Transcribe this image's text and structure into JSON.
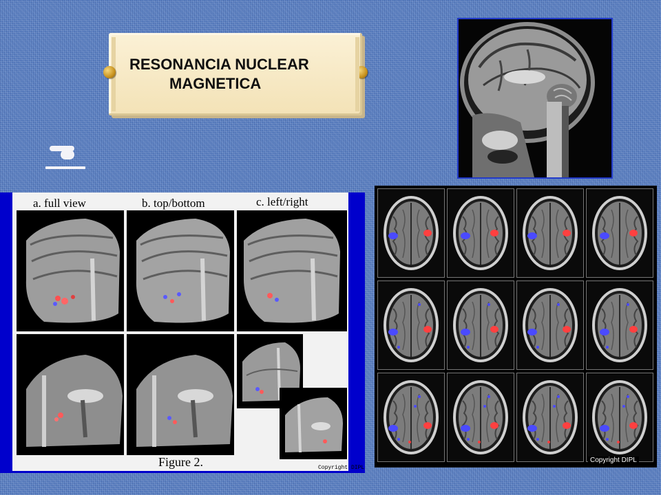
{
  "slide": {
    "title_line1": "RESONANCIA NUCLEAR",
    "title_line2": "MAGNETICA",
    "background_color": "#5a7fc0"
  },
  "figure_3d": {
    "labels": [
      "a. full view",
      "b. top/bottom",
      "c. left/right"
    ],
    "caption": "Figure 2.",
    "copyright": "Copyright DIPL",
    "background_color": "#0000cc"
  },
  "axial_grid": {
    "rows": 3,
    "cols": 4,
    "copyright": "Copyright DIPL"
  },
  "images": {
    "sagittal": "sagittal-mri-head-image",
    "brain_3d": "3d-brain-render-image",
    "axial_slices": "axial-fmri-slice-image"
  }
}
